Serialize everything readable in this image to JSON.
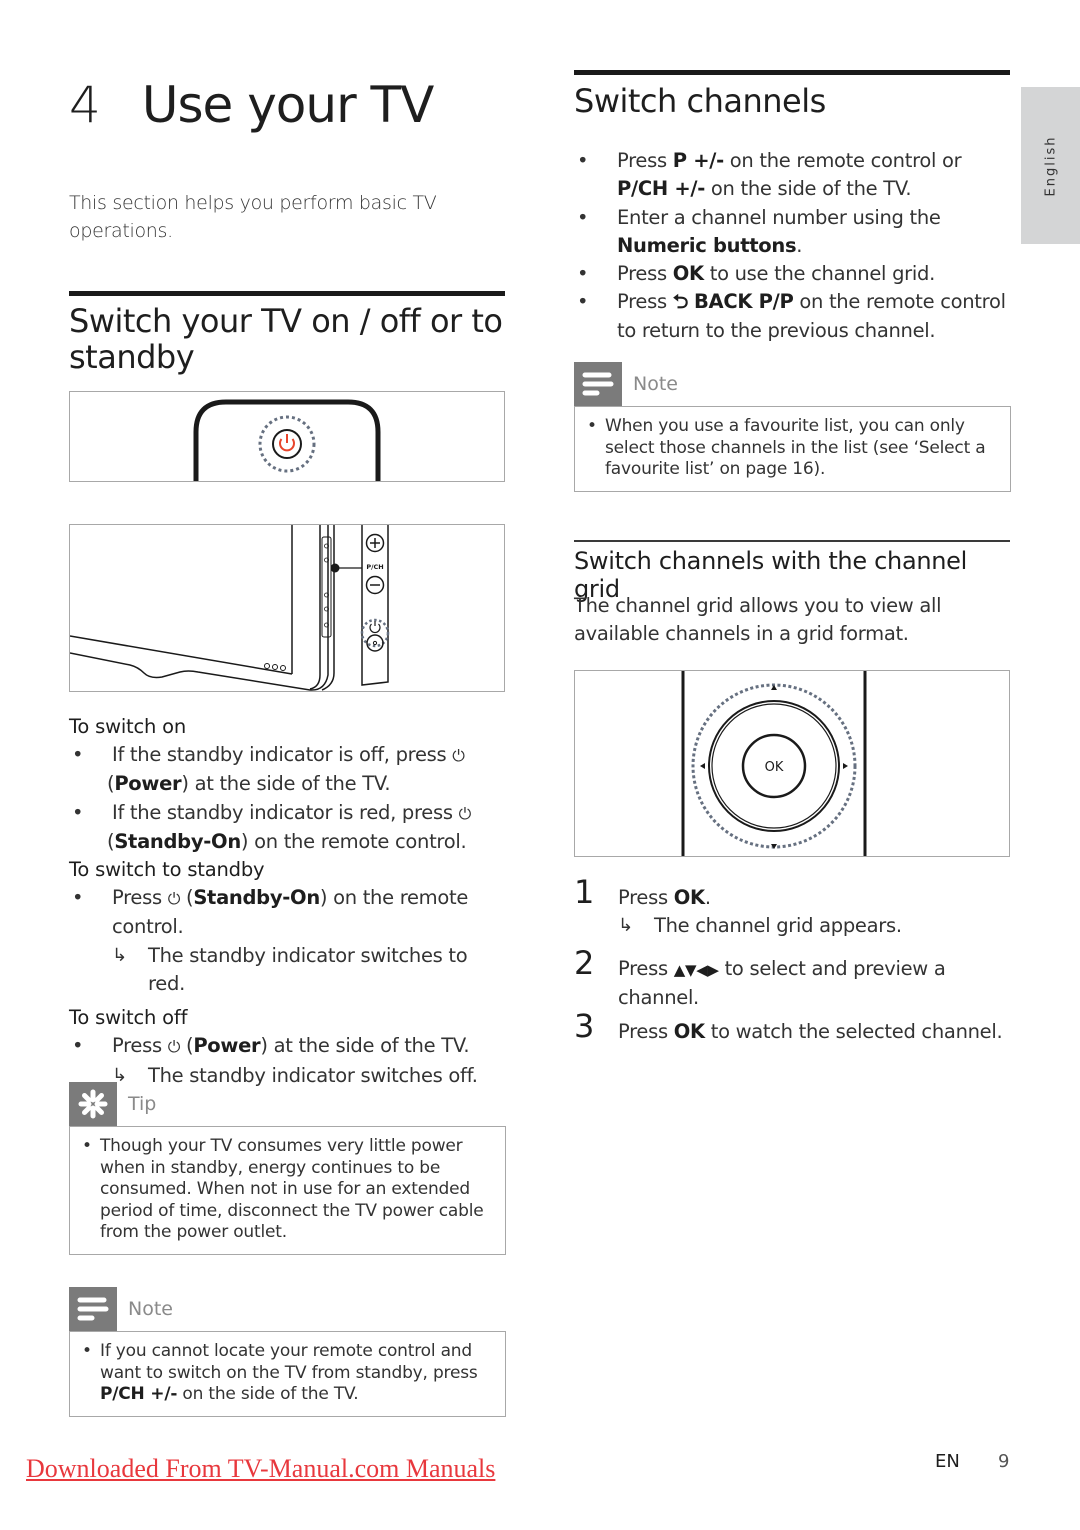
{
  "chapter": {
    "number": "4",
    "title": "Use your TV",
    "intro": "This section helps you perform basic TV operations."
  },
  "side_tab": {
    "label": "English"
  },
  "power_section": {
    "heading": "Switch your TV on / off or to standby",
    "figure_remote": {
      "icon": "power-button-icon",
      "accent": "#e8452c"
    },
    "figure_tv_side": {
      "label": "P/CH",
      "icons": [
        "plus-icon",
        "minus-icon",
        "power-icon"
      ]
    },
    "switch_on": {
      "title": "To switch on",
      "items": [
        {
          "pre": "If the standby indicator is off, press ",
          "icon": "power-icon",
          "open": " (",
          "bold": "Power",
          "post": ") at the side of the TV."
        },
        {
          "pre": "If the standby indicator is red, press ",
          "icon": "power-icon",
          "open": " (",
          "bold": "Standby-On",
          "post": ") on the remote control."
        }
      ]
    },
    "switch_standby": {
      "title": "To switch to standby",
      "items": [
        {
          "pre": "Press ",
          "icon": "power-icon",
          "open": " (",
          "bold": "Standby-On",
          "post": ") on the remote control.",
          "result": "The standby indicator switches to red."
        }
      ]
    },
    "switch_off": {
      "title": "To switch off",
      "items": [
        {
          "pre": "Press ",
          "icon": "power-icon",
          "open": " (",
          "bold": "Power",
          "post": ") at the side of the TV.",
          "result": "The standby indicator switches off."
        }
      ]
    },
    "tip": {
      "label": "Tip",
      "icon": "asterisk-icon",
      "text": "Though your TV consumes very little power when in standby, energy continues to be consumed. When not in use for an extended period of time, disconnect the TV power cable from the power outlet."
    },
    "note": {
      "label": "Note",
      "icon": "note-lines-icon",
      "pre": "If you cannot locate your remote control and want to switch on the TV from standby, press ",
      "bold": "P/CH +/-",
      "post": " on the side of the TV."
    }
  },
  "channels_section": {
    "heading": "Switch channels",
    "items": [
      {
        "pre": "Press ",
        "bold1": "P +/-",
        "mid": " on the remote control or ",
        "bold2": "P/CH +/-",
        "post": " on the side of the TV."
      },
      {
        "pre": "Enter a channel number using the ",
        "bold1": "Numeric buttons",
        "post": "."
      },
      {
        "pre": "Press ",
        "bold1": "OK",
        "post": " to use the channel grid."
      },
      {
        "pre": "Press ",
        "icon": "back-arrow-icon",
        "bold1": "BACK P/P",
        "post": " on the remote control to return to the previous channel."
      }
    ],
    "note": {
      "label": "Note",
      "icon": "note-lines-icon",
      "text": "When you use a favourite list, you can only select those channels in the list (see ‘Select a favourite list’ on page 16)."
    }
  },
  "grid_section": {
    "heading": "Switch channels with the channel grid",
    "intro": "The channel grid allows you to view all available channels in a grid format.",
    "figure": {
      "center_label": "OK"
    },
    "steps": [
      {
        "num": "1",
        "pre": "Press ",
        "bold": "OK",
        "post": ".",
        "result": "The channel grid appears."
      },
      {
        "num": "2",
        "pre": "Press ",
        "bold": "▲▼◀▶",
        "post": " to select and preview a channel."
      },
      {
        "num": "3",
        "pre": "Press ",
        "bold": "OK",
        "post": " to watch the selected channel."
      }
    ]
  },
  "footer": {
    "link_text": "Downloaded From TV-Manual.com Manuals",
    "lang": "EN",
    "page": "9"
  },
  "glyphs": {
    "bullet": "•",
    "result_arrow": "↳",
    "power": "⏻",
    "back": "⮌"
  },
  "colors": {
    "accent_red": "#e8383d",
    "callout_gray": "#7b7b7b",
    "tab_gray": "#d4d5d6"
  }
}
